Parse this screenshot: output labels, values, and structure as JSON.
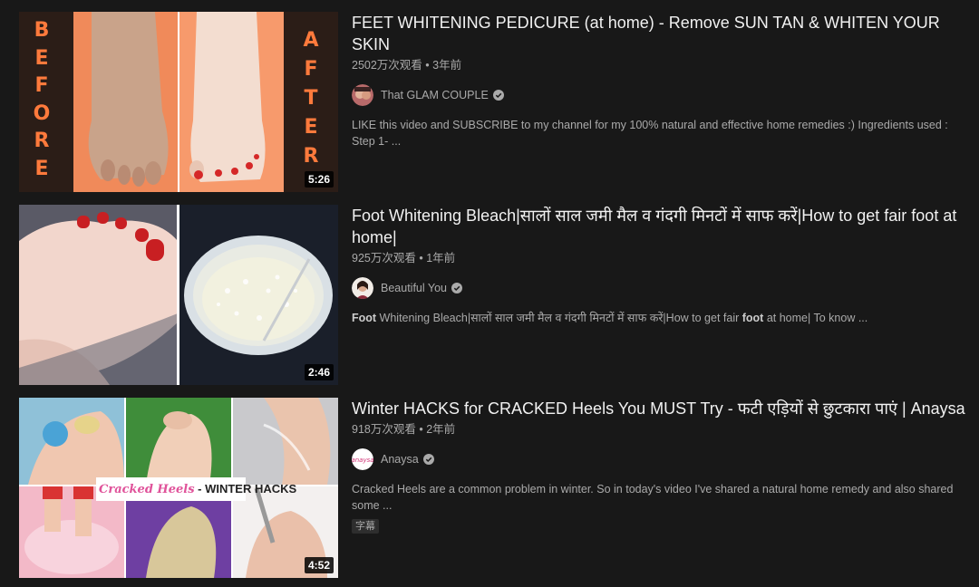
{
  "videos": [
    {
      "title": "FEET WHITENING PEDICURE (at home) - Remove SUN TAN & WHITEN YOUR SKIN",
      "views": "2502万次观看",
      "age": "3年前",
      "channel": "That GLAM COUPLE",
      "verified": true,
      "description": "LIKE this video and SUBSCRIBE to my channel for my 100% natural and effective home remedies :) Ingredients used : Step 1- ...",
      "duration": "5:26",
      "thumb_left_text": "BEFORE",
      "thumb_right_text": "AFTER"
    },
    {
      "title": "Foot Whitening Bleach|सालों साल जमी मैल व गंदगी मिनटों में साफ करें|How to get fair foot at home|",
      "views": "925万次观看",
      "age": "1年前",
      "channel": "Beautiful You",
      "verified": true,
      "description_parts": [
        "Foot",
        " Whitening Bleach|सालों साल जमी मैल व गंदगी मिनटों में साफ करें|How to get fair ",
        "foot",
        " at home| To know ..."
      ],
      "duration": "2:46"
    },
    {
      "title": "Winter HACKS for CRACKED Heels You MUST Try - फटी एड़ियों से छुटकारा पाएं | Anaysa",
      "views": "918万次观看",
      "age": "2年前",
      "channel": "Anaysa",
      "verified": true,
      "description": "Cracked Heels are a common problem in winter. So in today's video I've shared a natural home remedy and also shared some ...",
      "badge": "字幕",
      "duration": "4:52",
      "thumb_banner_left": "Cracked Heels",
      "thumb_banner_right": " - WINTER HACKS"
    }
  ],
  "meta_separator": "•",
  "icons": {
    "verified": "verified-check-icon"
  }
}
